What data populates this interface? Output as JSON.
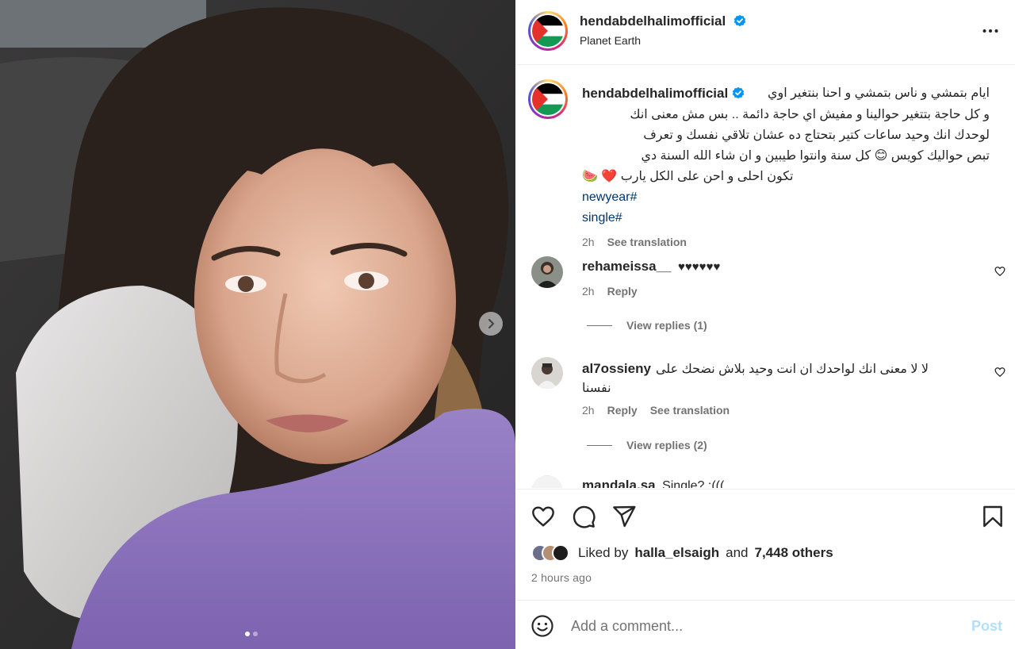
{
  "post": {
    "username": "hendabdelhalimofficial",
    "location": "Planet Earth",
    "carousel_index": 1,
    "carousel_count": 2
  },
  "caption": {
    "username": "hendabdelhalimofficial",
    "lines": [
      "ايام بتمشي و ناس بتمشي و احنا بنتغير اوي",
      "و كل حاجة بتتغير حوالينا و مفيش اي حاجة دائمة .. بس مش معنى انك",
      "لوحدك انك وحيد ساعات كتير بتحتاج ده عشان تلاقي نفسك و تعرف",
      "تبص حواليك كويس 😊 كل سنة وانتوا طيبين و ان شاء الله السنة دي",
      "تكون احلى و احن على الكل يارب ❤️ 🍉"
    ],
    "hashtags": [
      "newyear#",
      "single#"
    ],
    "time": "2h",
    "see_translation": "See translation"
  },
  "comments": [
    {
      "username": "rehameissa__",
      "text": "♥♥♥♥♥♥",
      "time": "2h",
      "reply": "Reply",
      "view_replies": "View replies (1)"
    },
    {
      "username": "al7ossieny",
      "text_line1": "لا لا معنى انك لواحدك ان انت وحيد بلاش نضحك على",
      "text_line2": "نفسنا",
      "time": "2h",
      "reply": "Reply",
      "see_translation": "See translation",
      "view_replies": "View replies (2)"
    },
    {
      "username": "mandala.sa",
      "text": "Single? :((("
    }
  ],
  "likes": {
    "prefix": "Liked by",
    "user": "halla_elsaigh",
    "and": "and",
    "others": "7,448 others"
  },
  "time_ago": "2 hours ago",
  "add_comment": {
    "placeholder": "Add a comment...",
    "post_label": "Post"
  },
  "colors": {
    "link": "#00376b",
    "verified": "#0095f6",
    "secondary_text": "#737373",
    "post_disabled": "#b2dffc",
    "heart_red": "#e0245e"
  },
  "icons": [
    "verified-icon",
    "more-icon",
    "heart-icon",
    "comment-icon",
    "share-icon",
    "bookmark-icon",
    "emoji-icon",
    "chevron-right-icon"
  ]
}
